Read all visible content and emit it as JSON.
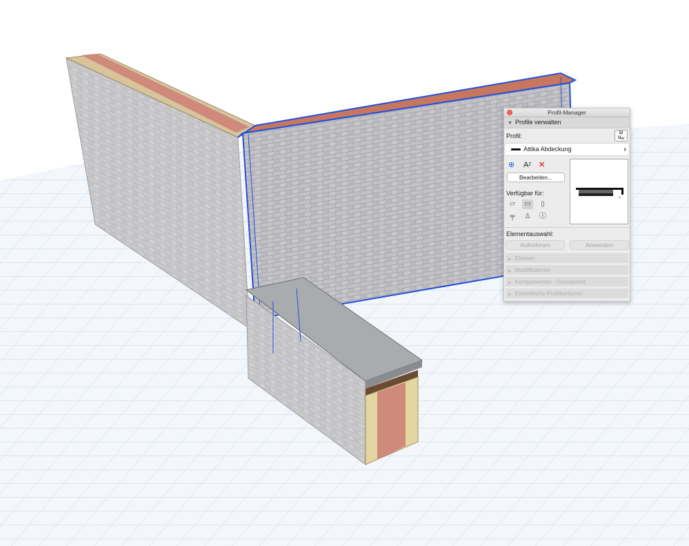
{
  "window": {
    "title": "Profil-Manager"
  },
  "section": {
    "title": "Profile verwalten"
  },
  "profile": {
    "label": "Profil:",
    "selected": "Attika Abdeckung",
    "ud_icon": "Uₐₑ"
  },
  "actions": {
    "edit_button": "Bearbeiten..."
  },
  "available": {
    "label": "Verfügbar für:"
  },
  "selection": {
    "label": "Elementauswahl:",
    "take_button": "Aufnehmen",
    "apply_button": "Anwenden"
  },
  "collapsed_sections": [
    "Ebenen",
    "Modifikatoren",
    "Komponenten - Grundeinst.",
    "Einheitliche Profilkonturen"
  ],
  "icons": [
    "close-icon",
    "add-icon",
    "rename-icon",
    "delete-icon",
    "chevron-right-icon",
    "wall-icon",
    "beam-icon",
    "column-icon",
    "railing-icon",
    "object-icon",
    "info-icon"
  ],
  "colors": {
    "accent": "#1a5fd8",
    "delete": "#e03020",
    "selection_outline": "#1f4fdc",
    "brick": "#c4c4c6",
    "insulation": "#e3d6a0",
    "core": "#cf8a7c",
    "coping": "#a7aaad",
    "wood": "#6a4a30"
  }
}
